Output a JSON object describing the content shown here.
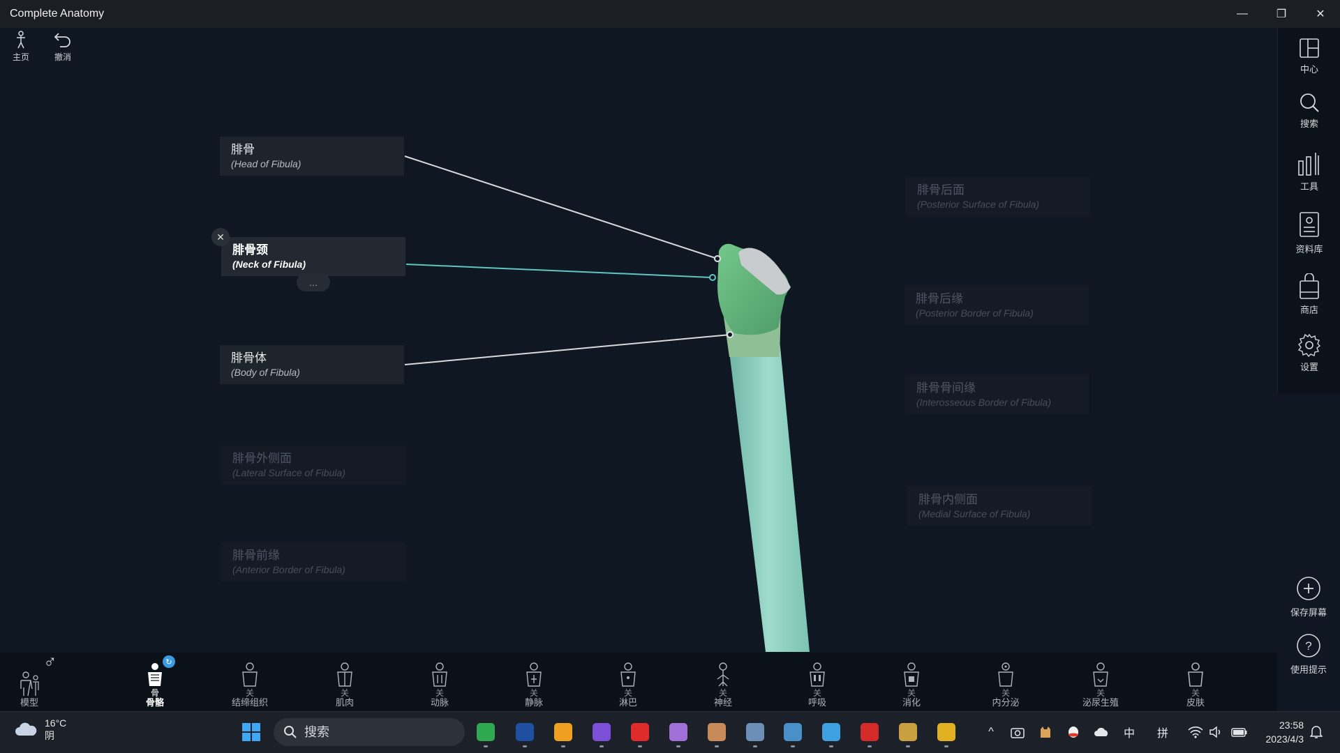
{
  "window": {
    "title": "Complete Anatomy",
    "minimize": "—",
    "restore": "❐",
    "close": "✕"
  },
  "top_left": {
    "home_label": "主页",
    "undo_label": "撤消"
  },
  "right_rail": {
    "items": [
      {
        "label": "中心",
        "icon": "layout-icon"
      },
      {
        "label": "搜索",
        "icon": "search-icon"
      },
      {
        "label": "工具",
        "icon": "tools-icon"
      },
      {
        "label": "资料库",
        "icon": "library-icon"
      },
      {
        "label": "商店",
        "icon": "shop-icon"
      },
      {
        "label": "设置",
        "icon": "gear-icon"
      }
    ],
    "save_screen_label": "保存屏幕",
    "help_label": "使用提示"
  },
  "labels": {
    "left": [
      {
        "cn": "腓骨",
        "en": "(Head of Fibula)",
        "state": "normal"
      },
      {
        "cn": "腓骨颈",
        "en": "(Neck of Fibula)",
        "state": "active"
      },
      {
        "cn": "腓骨体",
        "en": "(Body of Fibula)",
        "state": "normal"
      },
      {
        "cn": "腓骨外侧面",
        "en": "(Lateral Surface of Fibula)",
        "state": "dim"
      },
      {
        "cn": "腓骨前缘",
        "en": "(Anterior Border of Fibula)",
        "state": "dim"
      }
    ],
    "right": [
      {
        "cn": "腓骨后面",
        "en": "(Posterior Surface of Fibula)",
        "state": "dim"
      },
      {
        "cn": "腓骨后缘",
        "en": "(Posterior Border of Fibula)",
        "state": "dim"
      },
      {
        "cn": "腓骨骨间缘",
        "en": "(Interosseous Border of Fibula)",
        "state": "dim"
      },
      {
        "cn": "腓骨内侧面",
        "en": "(Medial Surface of Fibula)",
        "state": "dim"
      }
    ],
    "close_glyph": "✕",
    "more_glyph": "…"
  },
  "systems": {
    "model_label": "模型",
    "gender_glyph": "♂",
    "items": [
      {
        "state": "骨",
        "label": "骨骼",
        "active": true
      },
      {
        "state": "关",
        "label": "结缔组织",
        "active": false
      },
      {
        "state": "关",
        "label": "肌肉",
        "active": false
      },
      {
        "state": "关",
        "label": "动脉",
        "active": false
      },
      {
        "state": "关",
        "label": "静脉",
        "active": false
      },
      {
        "state": "关",
        "label": "淋巴",
        "active": false
      },
      {
        "state": "关",
        "label": "神经",
        "active": false
      },
      {
        "state": "关",
        "label": "呼吸",
        "active": false
      },
      {
        "state": "关",
        "label": "消化",
        "active": false
      },
      {
        "state": "关",
        "label": "内分泌",
        "active": false
      },
      {
        "state": "关",
        "label": "泌尿生殖",
        "active": false
      },
      {
        "state": "关",
        "label": "皮肤",
        "active": false
      }
    ]
  },
  "taskbar": {
    "weather_temp": "16°C",
    "weather_cond": "阴",
    "search_placeholder": "搜索",
    "apps": [
      {
        "name": "spreadsheet-app-icon",
        "color": "#2fa84f"
      },
      {
        "name": "cat-app-icon",
        "color": "#1e4fa0"
      },
      {
        "name": "g-app-icon",
        "color": "#f0a020"
      },
      {
        "name": "obsidian-app-icon",
        "color": "#7b4fd6"
      },
      {
        "name": "netease-music-icon",
        "color": "#e02b2b"
      },
      {
        "name": "anime-app-icon",
        "color": "#a070d8"
      },
      {
        "name": "anatomy-app-icon",
        "color": "#c98a5a"
      },
      {
        "name": "sandbox-app-icon",
        "color": "#6c8fb8"
      },
      {
        "name": "chart-app-icon",
        "color": "#4a90c8"
      },
      {
        "name": "board-app-icon",
        "color": "#3fa0e0"
      },
      {
        "name": "pdf-app-icon",
        "color": "#d42a2a"
      },
      {
        "name": "league-app-icon",
        "color": "#c8a040"
      },
      {
        "name": "chrome-app-icon",
        "color": "#e0b020"
      }
    ],
    "tray": {
      "chevron": "^",
      "ime_mode": "中",
      "ime_name": "拼"
    },
    "time": "23:58",
    "date": "2023/4/3"
  }
}
